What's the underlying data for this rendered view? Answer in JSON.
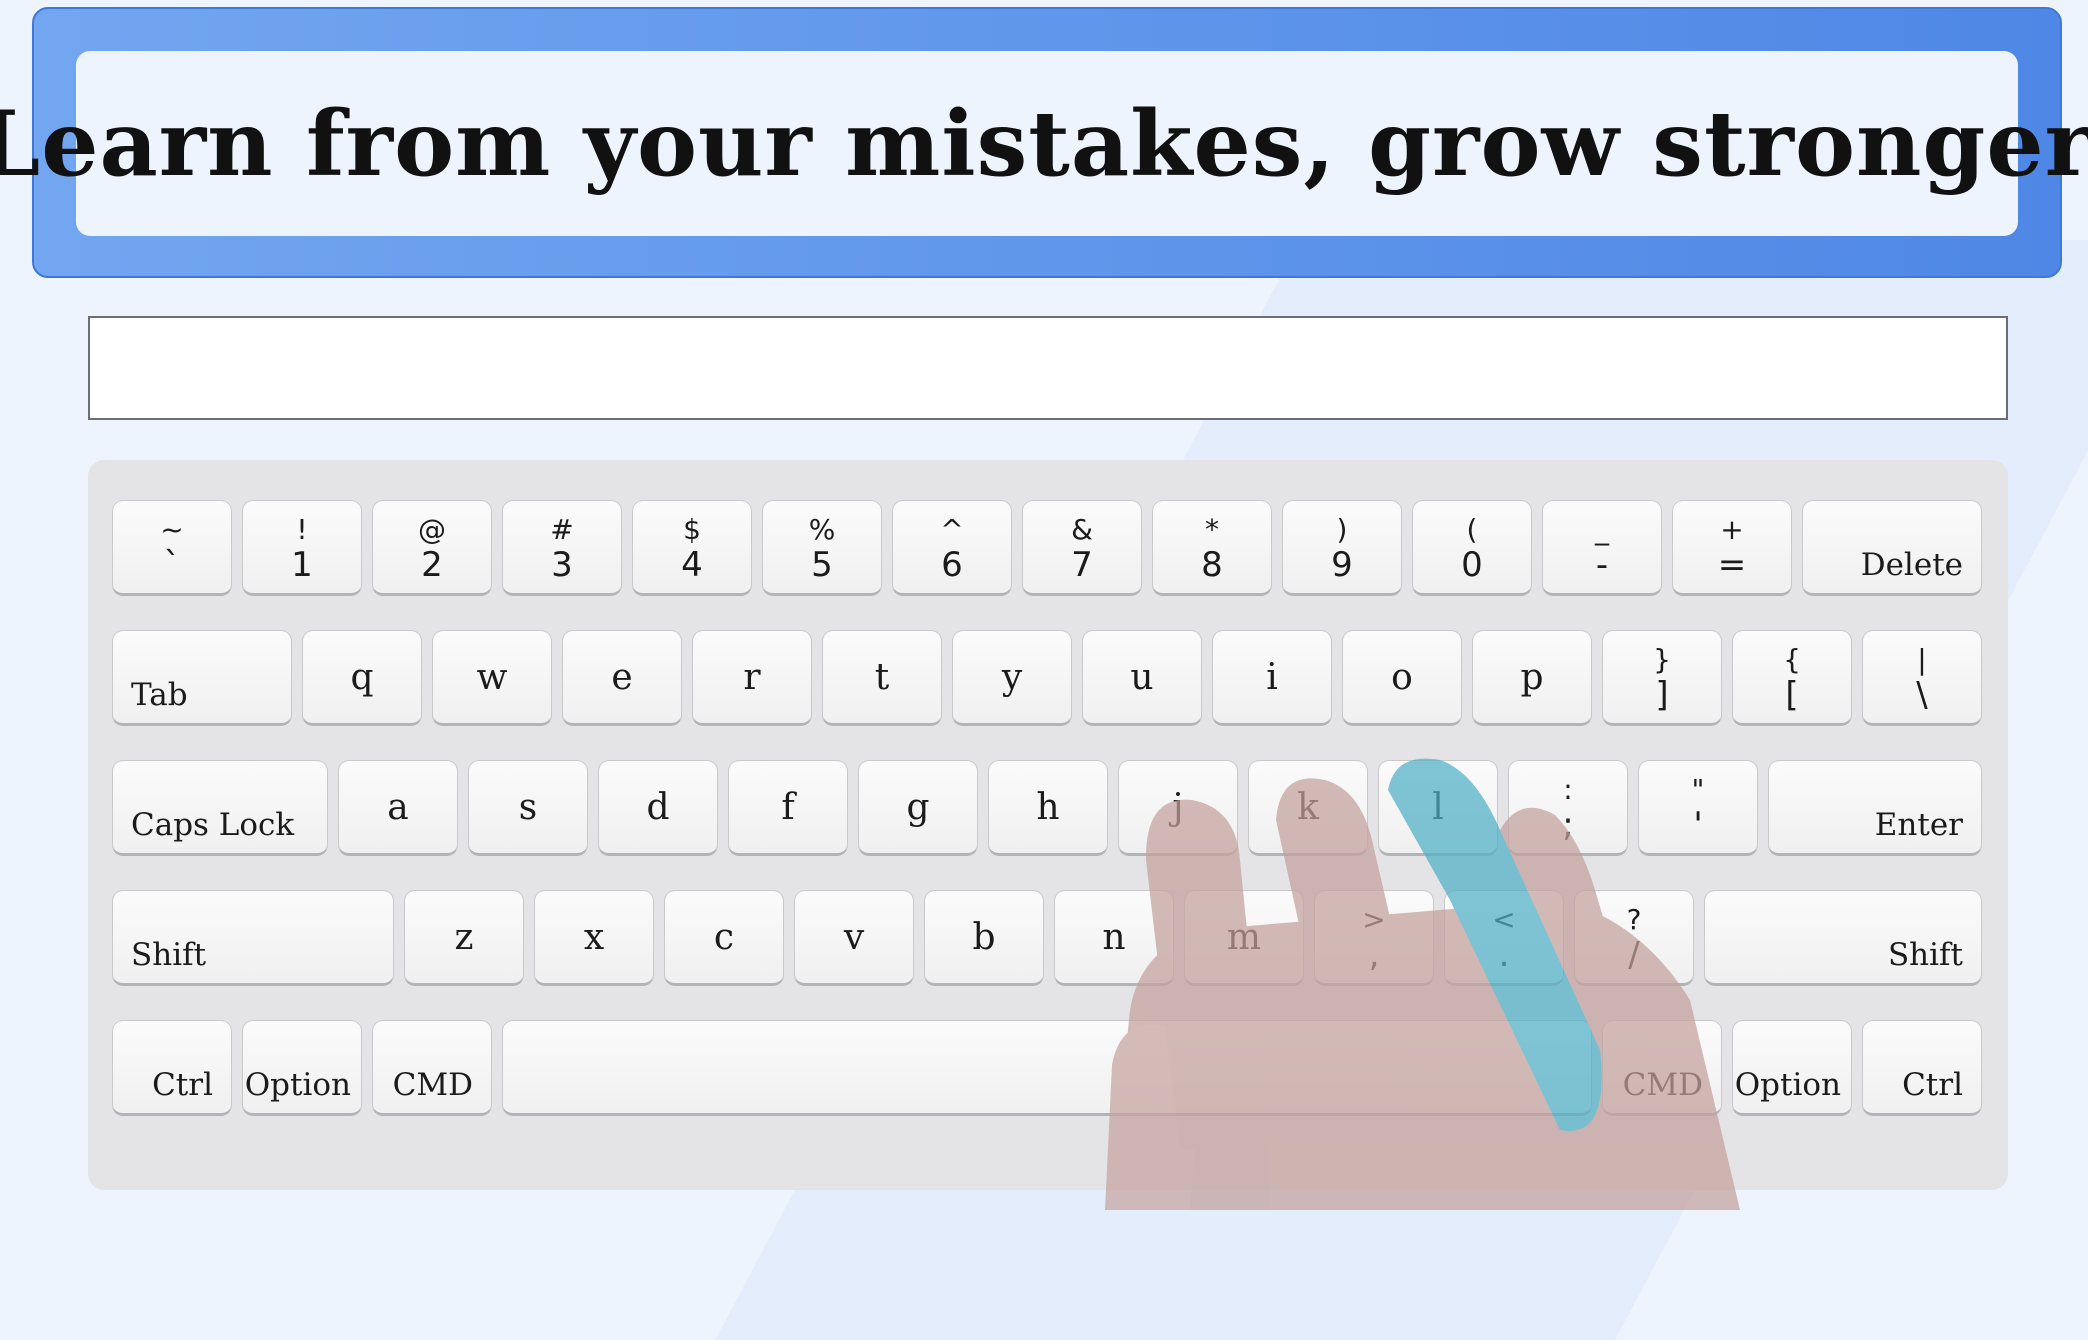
{
  "prompt": {
    "sentence": "Learn from your mistakes, grow stronger."
  },
  "input": {
    "value": "",
    "placeholder": ""
  },
  "keyboard": {
    "row1": [
      {
        "top": "~",
        "bot": "`"
      },
      {
        "top": "!",
        "bot": "1"
      },
      {
        "top": "@",
        "bot": "2"
      },
      {
        "top": "#",
        "bot": "3"
      },
      {
        "top": "$",
        "bot": "4"
      },
      {
        "top": "%",
        "bot": "5"
      },
      {
        "top": "^",
        "bot": "6"
      },
      {
        "top": "&",
        "bot": "7"
      },
      {
        "top": "*",
        "bot": "8"
      },
      {
        "top": ")",
        "bot": "9"
      },
      {
        "top": "(",
        "bot": "0"
      },
      {
        "top": "_",
        "bot": "-"
      },
      {
        "top": "+",
        "bot": "="
      },
      {
        "label": "Delete"
      }
    ],
    "row2": [
      {
        "label": "Tab"
      },
      {
        "char": "q"
      },
      {
        "char": "w"
      },
      {
        "char": "e"
      },
      {
        "char": "r"
      },
      {
        "char": "t"
      },
      {
        "char": "y"
      },
      {
        "char": "u"
      },
      {
        "char": "i"
      },
      {
        "char": "o"
      },
      {
        "char": "p"
      },
      {
        "top": "}",
        "bot": "]"
      },
      {
        "top": "{",
        "bot": "["
      },
      {
        "top": "|",
        "bot": "\\"
      }
    ],
    "row3": [
      {
        "label": "Caps Lock"
      },
      {
        "char": "a"
      },
      {
        "char": "s"
      },
      {
        "char": "d"
      },
      {
        "char": "f"
      },
      {
        "char": "g"
      },
      {
        "char": "h"
      },
      {
        "char": "j"
      },
      {
        "char": "k"
      },
      {
        "char": "l"
      },
      {
        "top": ":",
        "bot": ";"
      },
      {
        "top": "\"",
        "bot": "'"
      },
      {
        "label": "Enter"
      }
    ],
    "row4": [
      {
        "label": "Shift"
      },
      {
        "char": "z"
      },
      {
        "char": "x"
      },
      {
        "char": "c"
      },
      {
        "char": "v"
      },
      {
        "char": "b"
      },
      {
        "char": "n"
      },
      {
        "char": "m"
      },
      {
        "top": ">",
        "bot": ","
      },
      {
        "top": "<",
        "bot": "."
      },
      {
        "top": "?",
        "bot": "/"
      },
      {
        "label": "Shift"
      }
    ],
    "row5": [
      {
        "label": "Ctrl"
      },
      {
        "label": "Option"
      },
      {
        "label": "CMD"
      },
      {
        "label": ""
      },
      {
        "label": "CMD"
      },
      {
        "label": "Option"
      },
      {
        "label": "Ctrl"
      }
    ]
  },
  "hint": {
    "hand_icon": "right-hand-icon",
    "highlighted_finger": "ring",
    "highlighted_key": "l",
    "highlight_color": "#4fb0c6",
    "hand_color": "#c9a6a2"
  }
}
